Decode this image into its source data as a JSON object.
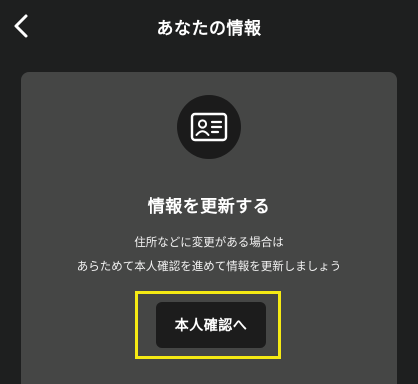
{
  "header": {
    "title": "あなたの情報",
    "back_icon": "chevron-left-icon"
  },
  "card": {
    "icon": "id-card-icon",
    "title": "情報を更新する",
    "description_line1": "住所などに変更がある場合は",
    "description_line2": "あらためて本人確認を進めて情報を更新しましょう",
    "button_label": "本人確認へ",
    "highlight_color": "#f5ea14"
  },
  "colors": {
    "background": "#1e1f1f",
    "card": "#454645",
    "button": "#1c1c1c",
    "text": "#ffffff"
  }
}
